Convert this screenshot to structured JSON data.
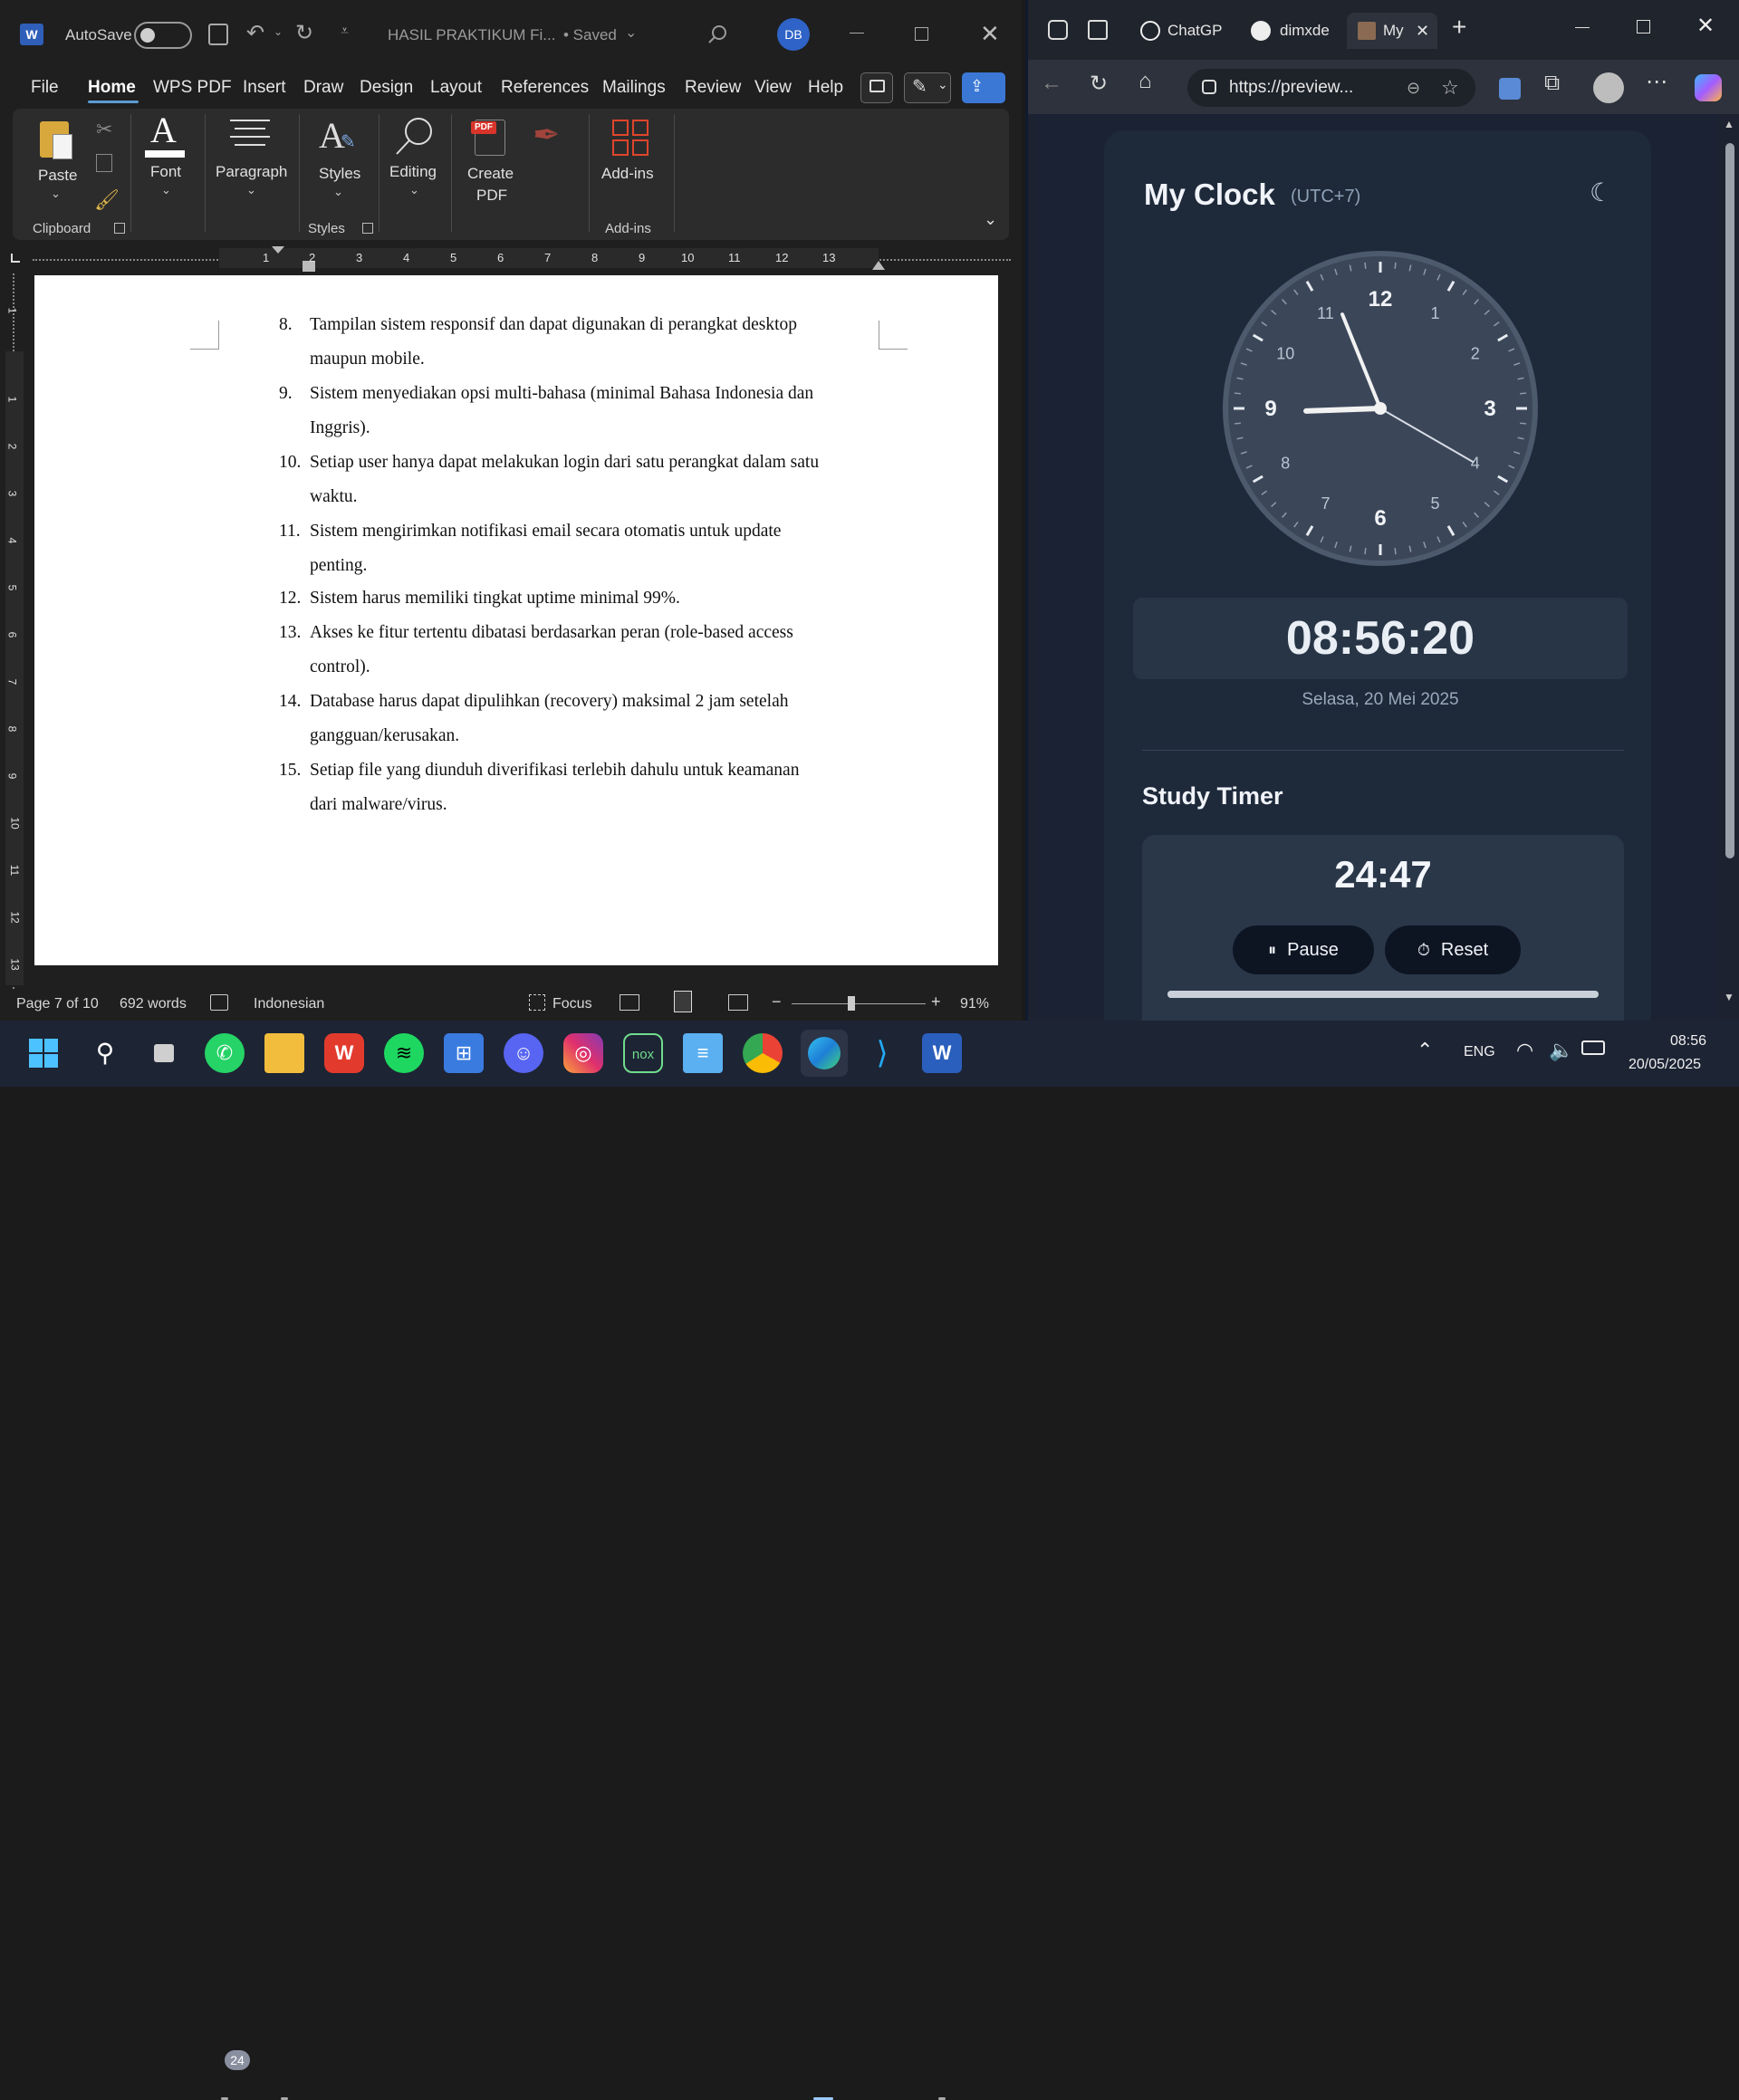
{
  "word": {
    "autosave_label": "AutoSave",
    "doc_title": "HASIL PRAKTIKUM Fi...",
    "saved_status": "• Saved",
    "avatar_initials": "DB",
    "menu": [
      "File",
      "Home",
      "WPS PDF",
      "Insert",
      "Draw",
      "Design",
      "Layout",
      "References",
      "Mailings",
      "Review",
      "View",
      "Help"
    ],
    "ribbon": {
      "paste": "Paste",
      "font": "Font",
      "paragraph": "Paragraph",
      "styles": "Styles",
      "editing": "Editing",
      "create_pdf_1": "Create",
      "create_pdf_2": "PDF",
      "pdf_badge": "PDF",
      "addins": "Add-ins",
      "group_clipboard": "Clipboard",
      "group_styles": "Styles",
      "group_addins": "Add-ins"
    },
    "ruler_numbers": [
      "1",
      "2",
      "3",
      "4",
      "5",
      "6",
      "7",
      "8",
      "9",
      "10",
      "11",
      "12",
      "13"
    ],
    "vruler_numbers": [
      "1",
      "1",
      "2",
      "3",
      "4",
      "5",
      "6",
      "7",
      "8",
      "9",
      "10",
      "11",
      "12",
      "13"
    ],
    "list": [
      {
        "n": "8.",
        "l1": "Tampilan sistem responsif dan dapat digunakan di perangkat desktop",
        "l2": "maupun mobile."
      },
      {
        "n": "9.",
        "l1": "Sistem menyediakan opsi multi-bahasa (minimal Bahasa Indonesia dan",
        "l2": "Inggris)."
      },
      {
        "n": "10.",
        "l1": "Setiap user hanya dapat melakukan login dari satu perangkat dalam satu",
        "l2": "waktu."
      },
      {
        "n": "11.",
        "l1": "Sistem mengirimkan notifikasi email secara otomatis untuk update",
        "l2": "penting."
      },
      {
        "n": "12.",
        "l1": "Sistem harus memiliki tingkat uptime minimal 99%.",
        "l2": ""
      },
      {
        "n": "13.",
        "l1": "Akses ke fitur tertentu dibatasi berdasarkan peran (role-based access",
        "l2": "control)."
      },
      {
        "n": "14.",
        "l1": "Database harus dapat dipulihkan (recovery) maksimal 2 jam setelah",
        "l2": "gangguan/kerusakan."
      },
      {
        "n": "15.",
        "l1": "Setiap file yang diunduh diverifikasi terlebih dahulu untuk keamanan",
        "l2": "dari malware/virus."
      }
    ],
    "status": {
      "page": "Page 7 of 10",
      "words": "692 words",
      "language": "Indonesian",
      "focus": "Focus",
      "zoom": "91%"
    }
  },
  "browser": {
    "tabs": [
      "ChatGP",
      "dimxde",
      "My"
    ],
    "url": "https://preview...",
    "clock": {
      "title": "My Clock",
      "timezone": "(UTC+7)",
      "numbers": [
        "12",
        "1",
        "2",
        "3",
        "4",
        "5",
        "6",
        "7",
        "8",
        "9",
        "10",
        "11"
      ],
      "time": "08:56:20",
      "date": "Selasa, 20 Mei 2025",
      "hour": 8,
      "minute": 56,
      "second": 20
    },
    "timer": {
      "title": "Study Timer",
      "value": "24:47",
      "pause": "Pause",
      "reset": "Reset",
      "progress": 0.99
    }
  },
  "taskbar": {
    "whatsapp_badge": "24",
    "nox_label": "nox",
    "language": "ENG",
    "time": "08:56",
    "date": "20/05/2025"
  },
  "colors": {
    "word_accent": "#5b9bd5",
    "clock_face": "#3b4759",
    "app_bg": "#1e293a",
    "taskbar": "#1d2434"
  }
}
